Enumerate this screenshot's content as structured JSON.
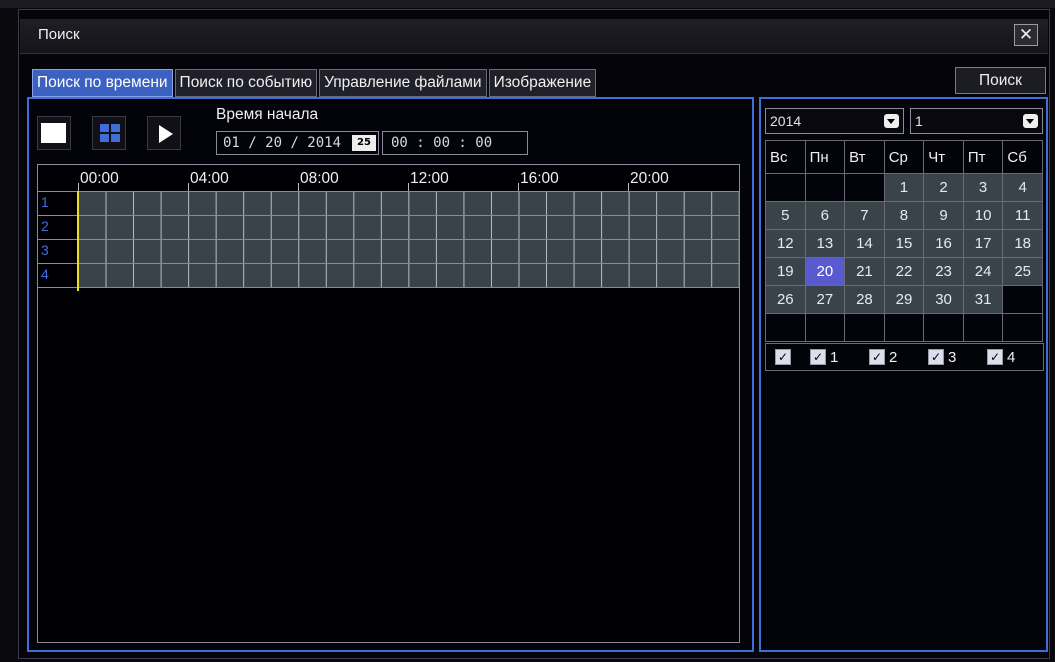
{
  "window": {
    "title": "Поиск",
    "close_glyph": "✕"
  },
  "tabs": [
    {
      "label": "Поиск по времени",
      "active": true
    },
    {
      "label": "Поиск по событию",
      "active": false
    },
    {
      "label": "Управление файлами",
      "active": false
    },
    {
      "label": "Изображение",
      "active": false
    }
  ],
  "search_button": "Поиск",
  "start_time": {
    "label": "Время начала",
    "date": "01 / 20 / 2014",
    "calendar_icon_text": "25",
    "time": "00  :  00  :  00"
  },
  "timeline": {
    "hours": [
      "00:00",
      "04:00",
      "08:00",
      "12:00",
      "16:00",
      "20:00"
    ],
    "channels": [
      "1",
      "2",
      "3",
      "4"
    ],
    "cursor_color": "#e8e020"
  },
  "calendar": {
    "year": "2014",
    "month": "1",
    "weekdays": [
      "Вс",
      "Пн",
      "Вт",
      "Ср",
      "Чт",
      "Пт",
      "Сб"
    ],
    "weeks": [
      [
        "",
        "",
        "",
        "1",
        "2",
        "3",
        "4"
      ],
      [
        "5",
        "6",
        "7",
        "8",
        "9",
        "10",
        "11"
      ],
      [
        "12",
        "13",
        "14",
        "15",
        "16",
        "17",
        "18"
      ],
      [
        "19",
        "20",
        "21",
        "22",
        "23",
        "24",
        "25"
      ],
      [
        "26",
        "27",
        "28",
        "29",
        "30",
        "31",
        ""
      ],
      [
        "",
        "",
        "",
        "",
        "",
        "",
        ""
      ]
    ],
    "selected_day": "20"
  },
  "channel_checkboxes": {
    "all_checked": true,
    "items": [
      {
        "label": "1",
        "checked": true
      },
      {
        "label": "2",
        "checked": true
      },
      {
        "label": "3",
        "checked": true
      },
      {
        "label": "4",
        "checked": true
      }
    ]
  },
  "colors": {
    "accent": "#3f6ed8",
    "grid_cell": "#3a434a",
    "selected_day": "#5a5ad0"
  }
}
